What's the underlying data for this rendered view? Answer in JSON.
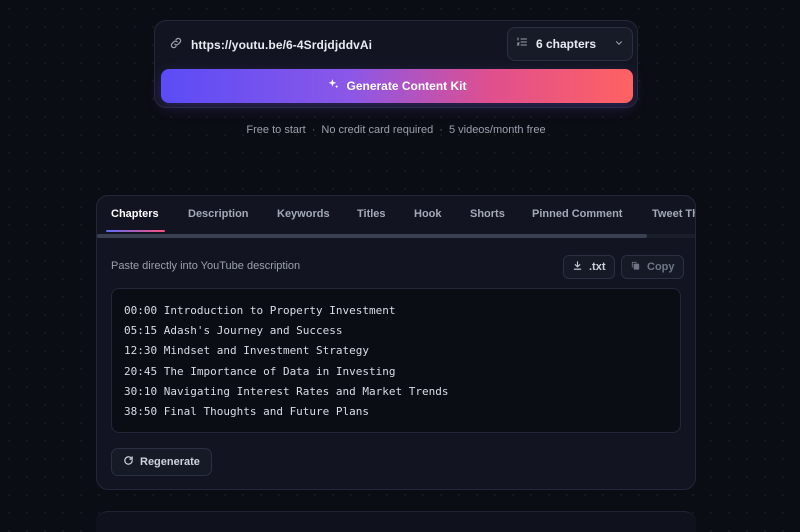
{
  "url_input": {
    "value": "https://youtu.be/6-4SrdjdjddvAi",
    "icon": "link-icon"
  },
  "chapters_select": {
    "label": "6 chapters",
    "icon": "list-ordered-icon"
  },
  "generate_button": {
    "label": "Generate Content Kit",
    "icon": "sparkles-icon"
  },
  "subnote": {
    "parts": [
      "Free to start",
      "No credit card required",
      "5 videos/month free"
    ],
    "separator": "·"
  },
  "tabs": [
    {
      "label": "Chapters",
      "active": true
    },
    {
      "label": "Description"
    },
    {
      "label": "Keywords"
    },
    {
      "label": "Titles"
    },
    {
      "label": "Hook"
    },
    {
      "label": "Shorts"
    },
    {
      "label": "Pinned Comment"
    },
    {
      "label": "Tweet Th"
    }
  ],
  "panel": {
    "hint": "Paste directly into YouTube description",
    "download_label": ".txt",
    "copy_label": "Copy",
    "regenerate_label": "Regenerate"
  },
  "chapters": [
    "00:00 Introduction to Property Investment",
    "05:15 Adash's Journey and Success",
    "12:30 Mindset and Investment Strategy",
    "20:45 The Importance of Data in Investing",
    "30:10 Navigating Interest Rates and Market Trends",
    "38:50 Final Thoughts and Future Plans"
  ],
  "colors": {
    "background": "#0b0d14",
    "accent_start": "#5b4cf6",
    "accent_end": "#ff6262"
  }
}
